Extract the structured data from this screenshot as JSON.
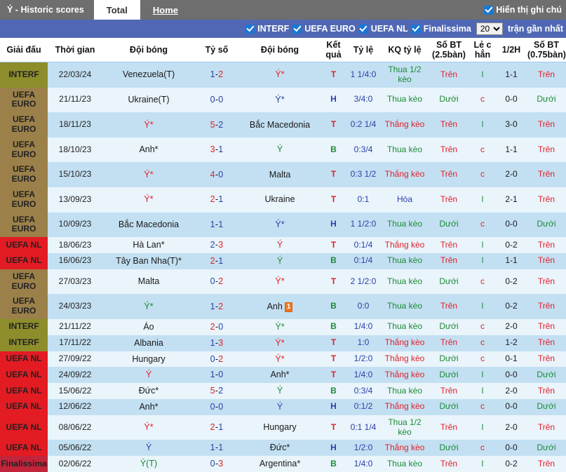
{
  "topbar": {
    "title": "Ý - Historic scores",
    "tab_total": "Total",
    "tab_home": "Home",
    "show_notes_label": "Hiển thị ghi chú"
  },
  "filterbar": {
    "items": [
      {
        "label": "INTERF"
      },
      {
        "label": "UEFA EURO"
      },
      {
        "label": "UEFA NL"
      },
      {
        "label": "Finalissima"
      }
    ],
    "count_value": "20",
    "count_options": [
      "10",
      "20",
      "30",
      "50"
    ],
    "tail_label": "trận gần nhất"
  },
  "table": {
    "headers": [
      "Giải đấu",
      "Thời gian",
      "Đội bóng",
      "Tỷ số",
      "Đội bóng",
      "Kết quả",
      "Tỷ lệ",
      "KQ tỷ lệ",
      "Số BT (2.5bàn)",
      "Lẻ c hẳn",
      "1/2H",
      "Số BT (0.75bàn)"
    ],
    "rows": [
      {
        "league": "INTERF",
        "league_class": "lg-interf",
        "date": "22/03/24",
        "home": "Venezuela(T)",
        "home_color": "c-dark",
        "hs": "1",
        "hs_color": "c-blue",
        "as": "2",
        "as_color": "c-red",
        "away": "Ý*",
        "away_color": "c-red",
        "away_card": "",
        "result": "T",
        "result_color": "c-red",
        "odds": "1 1/4:0",
        "odds_result": "Thua 1/2 kèo",
        "odds_result_color": "c-green",
        "ou25": "Trên",
        "ou25_color": "c-red",
        "oddeven": "l",
        "oddeven_color": "c-green",
        "half": "1-1",
        "ou075": "Trên",
        "ou075_color": "c-red"
      },
      {
        "league": "UEFA EURO",
        "league_class": "lg-euro",
        "date": "21/11/23",
        "home": "Ukraine(T)",
        "home_color": "c-dark",
        "hs": "0",
        "hs_color": "c-blue",
        "as": "0",
        "as_color": "c-blue",
        "away": "Ý*",
        "away_color": "c-blue",
        "away_card": "",
        "result": "H",
        "result_color": "c-blue",
        "odds": "3/4:0",
        "odds_result": "Thua kèo",
        "odds_result_color": "c-green",
        "ou25": "Dưới",
        "ou25_color": "c-green",
        "oddeven": "c",
        "oddeven_color": "c-red",
        "half": "0-0",
        "ou075": "Dưới",
        "ou075_color": "c-green"
      },
      {
        "league": "UEFA EURO",
        "league_class": "lg-euro",
        "date": "18/11/23",
        "home": "Ý*",
        "home_color": "c-red",
        "hs": "5",
        "hs_color": "c-red",
        "as": "2",
        "as_color": "c-blue",
        "away": "Bắc Macedonia",
        "away_color": "c-dark",
        "away_card": "",
        "result": "T",
        "result_color": "c-red",
        "odds": "0:2 1/4",
        "odds_result": "Thắng kèo",
        "odds_result_color": "c-red",
        "ou25": "Trên",
        "ou25_color": "c-red",
        "oddeven": "l",
        "oddeven_color": "c-green",
        "half": "3-0",
        "ou075": "Trên",
        "ou075_color": "c-red"
      },
      {
        "league": "UEFA EURO",
        "league_class": "lg-euro",
        "date": "18/10/23",
        "home": "Anh*",
        "home_color": "c-dark",
        "hs": "3",
        "hs_color": "c-red",
        "as": "1",
        "as_color": "c-blue",
        "away": "Ý",
        "away_color": "c-green",
        "away_card": "",
        "result": "B",
        "result_color": "c-green",
        "odds": "0:3/4",
        "odds_result": "Thua kèo",
        "odds_result_color": "c-green",
        "ou25": "Trên",
        "ou25_color": "c-red",
        "oddeven": "c",
        "oddeven_color": "c-red",
        "half": "1-1",
        "ou075": "Trên",
        "ou075_color": "c-red"
      },
      {
        "league": "UEFA EURO",
        "league_class": "lg-euro",
        "date": "15/10/23",
        "home": "Ý*",
        "home_color": "c-red",
        "hs": "4",
        "hs_color": "c-red",
        "as": "0",
        "as_color": "c-blue",
        "away": "Malta",
        "away_color": "c-dark",
        "away_card": "",
        "result": "T",
        "result_color": "c-red",
        "odds": "0:3 1/2",
        "odds_result": "Thắng kèo",
        "odds_result_color": "c-red",
        "ou25": "Trên",
        "ou25_color": "c-red",
        "oddeven": "c",
        "oddeven_color": "c-red",
        "half": "2-0",
        "ou075": "Trên",
        "ou075_color": "c-red"
      },
      {
        "league": "UEFA EURO",
        "league_class": "lg-euro",
        "date": "13/09/23",
        "home": "Ý*",
        "home_color": "c-red",
        "hs": "2",
        "hs_color": "c-red",
        "as": "1",
        "as_color": "c-blue",
        "away": "Ukraine",
        "away_color": "c-dark",
        "away_card": "",
        "result": "T",
        "result_color": "c-red",
        "odds": "0:1",
        "odds_result": "Hòa",
        "odds_result_color": "c-blue",
        "ou25": "Trên",
        "ou25_color": "c-red",
        "oddeven": "l",
        "oddeven_color": "c-green",
        "half": "2-1",
        "ou075": "Trên",
        "ou075_color": "c-red"
      },
      {
        "league": "UEFA EURO",
        "league_class": "lg-euro",
        "date": "10/09/23",
        "home": "Bắc Macedonia",
        "home_color": "c-dark",
        "hs": "1",
        "hs_color": "c-blue",
        "as": "1",
        "as_color": "c-blue",
        "away": "Ý*",
        "away_color": "c-blue",
        "away_card": "",
        "result": "H",
        "result_color": "c-blue",
        "odds": "1 1/2:0",
        "odds_result": "Thua kèo",
        "odds_result_color": "c-green",
        "ou25": "Dưới",
        "ou25_color": "c-green",
        "oddeven": "c",
        "oddeven_color": "c-red",
        "half": "0-0",
        "ou075": "Dưới",
        "ou075_color": "c-green"
      },
      {
        "league": "UEFA NL",
        "league_class": "lg-nl",
        "date": "18/06/23",
        "home": "Hà Lan*",
        "home_color": "c-dark",
        "hs": "2",
        "hs_color": "c-blue",
        "as": "3",
        "as_color": "c-red",
        "away": "Ý",
        "away_color": "c-red",
        "away_card": "",
        "result": "T",
        "result_color": "c-red",
        "odds": "0:1/4",
        "odds_result": "Thắng kèo",
        "odds_result_color": "c-red",
        "ou25": "Trên",
        "ou25_color": "c-red",
        "oddeven": "l",
        "oddeven_color": "c-green",
        "half": "0-2",
        "ou075": "Trên",
        "ou075_color": "c-red"
      },
      {
        "league": "UEFA NL",
        "league_class": "lg-nl",
        "date": "16/06/23",
        "home": "Tây Ban Nha(T)*",
        "home_color": "c-dark",
        "hs": "2",
        "hs_color": "c-red",
        "as": "1",
        "as_color": "c-blue",
        "away": "Ý",
        "away_color": "c-green",
        "away_card": "",
        "result": "B",
        "result_color": "c-green",
        "odds": "0:1/4",
        "odds_result": "Thua kèo",
        "odds_result_color": "c-green",
        "ou25": "Trên",
        "ou25_color": "c-red",
        "oddeven": "l",
        "oddeven_color": "c-green",
        "half": "1-1",
        "ou075": "Trên",
        "ou075_color": "c-red"
      },
      {
        "league": "UEFA EURO",
        "league_class": "lg-euro",
        "date": "27/03/23",
        "home": "Malta",
        "home_color": "c-dark",
        "hs": "0",
        "hs_color": "c-blue",
        "as": "2",
        "as_color": "c-red",
        "away": "Ý*",
        "away_color": "c-red",
        "away_card": "",
        "result": "T",
        "result_color": "c-red",
        "odds": "2 1/2:0",
        "odds_result": "Thua kèo",
        "odds_result_color": "c-green",
        "ou25": "Dưới",
        "ou25_color": "c-green",
        "oddeven": "c",
        "oddeven_color": "c-red",
        "half": "0-2",
        "ou075": "Trên",
        "ou075_color": "c-red"
      },
      {
        "league": "UEFA EURO",
        "league_class": "lg-euro",
        "date": "24/03/23",
        "home": "Ý*",
        "home_color": "c-green",
        "hs": "1",
        "hs_color": "c-blue",
        "as": "2",
        "as_color": "c-red",
        "away": "Anh",
        "away_color": "c-dark",
        "away_card": "1",
        "result": "B",
        "result_color": "c-green",
        "odds": "0:0",
        "odds_result": "Thua kèo",
        "odds_result_color": "c-green",
        "ou25": "Trên",
        "ou25_color": "c-red",
        "oddeven": "l",
        "oddeven_color": "c-green",
        "half": "0-2",
        "ou075": "Trên",
        "ou075_color": "c-red"
      },
      {
        "league": "INTERF",
        "league_class": "lg-interf",
        "date": "21/11/22",
        "home": "Áo",
        "home_color": "c-dark",
        "hs": "2",
        "hs_color": "c-red",
        "as": "0",
        "as_color": "c-blue",
        "away": "Ý*",
        "away_color": "c-green",
        "away_card": "",
        "result": "B",
        "result_color": "c-green",
        "odds": "1/4:0",
        "odds_result": "Thua kèo",
        "odds_result_color": "c-green",
        "ou25": "Dưới",
        "ou25_color": "c-green",
        "oddeven": "c",
        "oddeven_color": "c-red",
        "half": "2-0",
        "ou075": "Trên",
        "ou075_color": "c-red"
      },
      {
        "league": "INTERF",
        "league_class": "lg-interf",
        "date": "17/11/22",
        "home": "Albania",
        "home_color": "c-dark",
        "hs": "1",
        "hs_color": "c-blue",
        "as": "3",
        "as_color": "c-red",
        "away": "Ý*",
        "away_color": "c-red",
        "away_card": "",
        "result": "T",
        "result_color": "c-red",
        "odds": "1:0",
        "odds_result": "Thắng kèo",
        "odds_result_color": "c-red",
        "ou25": "Trên",
        "ou25_color": "c-red",
        "oddeven": "c",
        "oddeven_color": "c-red",
        "half": "1-2",
        "ou075": "Trên",
        "ou075_color": "c-red"
      },
      {
        "league": "UEFA NL",
        "league_class": "lg-nl",
        "date": "27/09/22",
        "home": "Hungary",
        "home_color": "c-dark",
        "hs": "0",
        "hs_color": "c-blue",
        "as": "2",
        "as_color": "c-red",
        "away": "Ý*",
        "away_color": "c-red",
        "away_card": "",
        "result": "T",
        "result_color": "c-red",
        "odds": "1/2:0",
        "odds_result": "Thắng kèo",
        "odds_result_color": "c-red",
        "ou25": "Dưới",
        "ou25_color": "c-green",
        "oddeven": "c",
        "oddeven_color": "c-red",
        "half": "0-1",
        "ou075": "Trên",
        "ou075_color": "c-red"
      },
      {
        "league": "UEFA NL",
        "league_class": "lg-nl",
        "date": "24/09/22",
        "home": "Ý",
        "home_color": "c-red",
        "hs": "1",
        "hs_color": "c-blue",
        "as": "0",
        "as_color": "c-blue",
        "away": "Anh*",
        "away_color": "c-dark",
        "away_card": "",
        "result": "T",
        "result_color": "c-red",
        "odds": "1/4:0",
        "odds_result": "Thắng kèo",
        "odds_result_color": "c-red",
        "ou25": "Dưới",
        "ou25_color": "c-green",
        "oddeven": "l",
        "oddeven_color": "c-green",
        "half": "0-0",
        "ou075": "Dưới",
        "ou075_color": "c-green"
      },
      {
        "league": "UEFA NL",
        "league_class": "lg-nl",
        "date": "15/06/22",
        "home": "Đức*",
        "home_color": "c-dark",
        "hs": "5",
        "hs_color": "c-red",
        "as": "2",
        "as_color": "c-blue",
        "away": "Ý",
        "away_color": "c-green",
        "away_card": "",
        "result": "B",
        "result_color": "c-green",
        "odds": "0:3/4",
        "odds_result": "Thua kèo",
        "odds_result_color": "c-green",
        "ou25": "Trên",
        "ou25_color": "c-red",
        "oddeven": "l",
        "oddeven_color": "c-green",
        "half": "2-0",
        "ou075": "Trên",
        "ou075_color": "c-red"
      },
      {
        "league": "UEFA NL",
        "league_class": "lg-nl",
        "date": "12/06/22",
        "home": "Anh*",
        "home_color": "c-dark",
        "hs": "0",
        "hs_color": "c-blue",
        "as": "0",
        "as_color": "c-blue",
        "away": "Ý",
        "away_color": "c-blue",
        "away_card": "",
        "result": "H",
        "result_color": "c-blue",
        "odds": "0:1/2",
        "odds_result": "Thắng kèo",
        "odds_result_color": "c-red",
        "ou25": "Dưới",
        "ou25_color": "c-green",
        "oddeven": "c",
        "oddeven_color": "c-red",
        "half": "0-0",
        "ou075": "Dưới",
        "ou075_color": "c-green"
      },
      {
        "league": "UEFA NL",
        "league_class": "lg-nl",
        "date": "08/06/22",
        "home": "Ý*",
        "home_color": "c-red",
        "hs": "2",
        "hs_color": "c-red",
        "as": "1",
        "as_color": "c-blue",
        "away": "Hungary",
        "away_color": "c-dark",
        "away_card": "",
        "result": "T",
        "result_color": "c-red",
        "odds": "0:1 1/4",
        "odds_result": "Thua 1/2 kèo",
        "odds_result_color": "c-green",
        "ou25": "Trên",
        "ou25_color": "c-red",
        "oddeven": "l",
        "oddeven_color": "c-green",
        "half": "2-0",
        "ou075": "Trên",
        "ou075_color": "c-red"
      },
      {
        "league": "UEFA NL",
        "league_class": "lg-nl",
        "date": "05/06/22",
        "home": "Ý",
        "home_color": "c-blue",
        "hs": "1",
        "hs_color": "c-blue",
        "as": "1",
        "as_color": "c-blue",
        "away": "Đức*",
        "away_color": "c-dark",
        "away_card": "",
        "result": "H",
        "result_color": "c-blue",
        "odds": "1/2:0",
        "odds_result": "Thắng kèo",
        "odds_result_color": "c-red",
        "ou25": "Dưới",
        "ou25_color": "c-green",
        "oddeven": "c",
        "oddeven_color": "c-red",
        "half": "0-0",
        "ou075": "Dưới",
        "ou075_color": "c-green"
      },
      {
        "league": "Finalissima",
        "league_class": "lg-fin",
        "date": "02/06/22",
        "home": "Ý(T)",
        "home_color": "c-green",
        "hs": "0",
        "hs_color": "c-blue",
        "as": "3",
        "as_color": "c-red",
        "away": "Argentina*",
        "away_color": "c-dark",
        "away_card": "",
        "result": "B",
        "result_color": "c-green",
        "odds": "1/4:0",
        "odds_result": "Thua kèo",
        "odds_result_color": "c-green",
        "ou25": "Trên",
        "ou25_color": "c-red",
        "oddeven": "l",
        "oddeven_color": "c-green",
        "half": "0-2",
        "ou075": "Trên",
        "ou075_color": "c-red"
      }
    ]
  }
}
